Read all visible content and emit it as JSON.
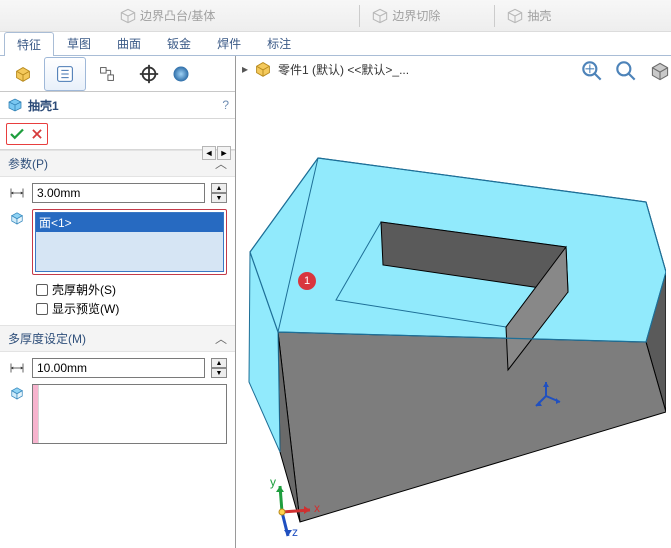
{
  "toolbar": {
    "boss_label": "边界凸台/基体",
    "cut_label": "边界切除",
    "shell_label": "抽壳"
  },
  "tabs": {
    "feature": "特征",
    "sketch": "草图",
    "surface": "曲面",
    "sheet": "钣金",
    "weld": "焊件",
    "annot": "标注"
  },
  "feature": {
    "name": "抽壳1",
    "help": "?"
  },
  "params": {
    "title": "参数(P)",
    "d1_value": "3.00mm",
    "face_sel": "面<1>",
    "outward": "壳厚朝外(S)",
    "preview": "显示预览(W)"
  },
  "multi": {
    "title": "多厚度设定(M)",
    "d1_value": "10.00mm"
  },
  "tree": {
    "part": "零件1 (默认) <<默认>_..."
  },
  "annot": "1",
  "axes": {
    "x": "x",
    "y": "y",
    "z": "z"
  }
}
